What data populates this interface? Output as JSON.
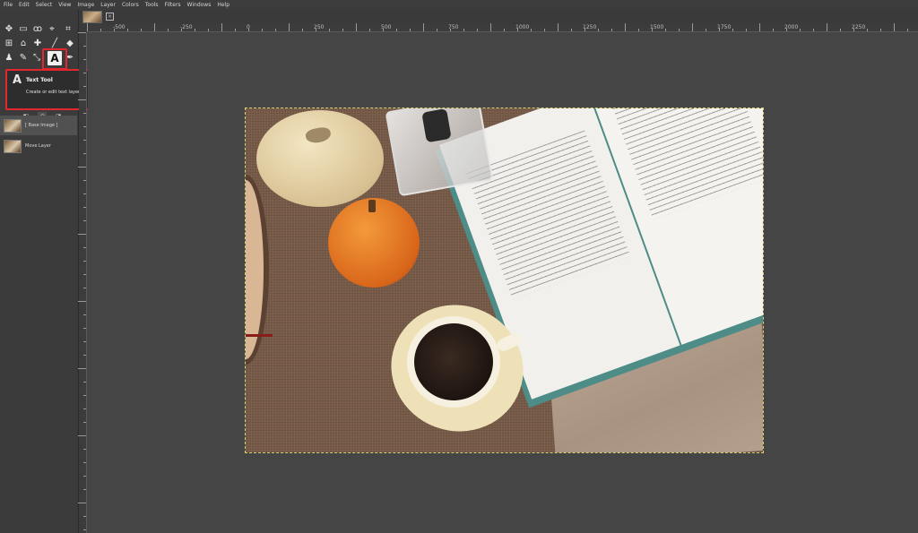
{
  "menubar": {
    "items": [
      "File",
      "Edit",
      "Select",
      "View",
      "Image",
      "Layer",
      "Colors",
      "Tools",
      "Filters",
      "Windows",
      "Help"
    ]
  },
  "toolbox": {
    "tools": [
      {
        "name": "move-tool-icon",
        "glyph": "✥"
      },
      {
        "name": "rect-select-tool-icon",
        "glyph": "▭"
      },
      {
        "name": "lasso-tool-icon",
        "glyph": "ꝏ"
      },
      {
        "name": "foreground-select-tool-icon",
        "glyph": "⌖"
      },
      {
        "name": "crop-tool-icon",
        "glyph": "⌗"
      },
      {
        "name": "unified-transform-tool-icon",
        "glyph": "⊞"
      },
      {
        "name": "warp-tool-icon",
        "glyph": "⌂"
      },
      {
        "name": "cage-tool-icon",
        "glyph": "✚"
      },
      {
        "name": "paintbrush-tool-icon",
        "glyph": "╱"
      },
      {
        "name": "eraser-tool-icon",
        "glyph": "◆"
      },
      {
        "name": "clone-tool-icon",
        "glyph": "♟"
      },
      {
        "name": "smudge-tool-icon",
        "glyph": "✎"
      },
      {
        "name": "measure-tool-icon",
        "glyph": "⤡"
      },
      {
        "name": "text-tool-icon",
        "glyph": "A"
      },
      {
        "name": "color-picker-tool-icon",
        "glyph": "✒"
      }
    ]
  },
  "tooltip": {
    "icon": "A",
    "title": "Text Tool",
    "help": "?",
    "description": "Create or edit text layers"
  },
  "layers": {
    "tabs": [
      "layers-tab-icon",
      "channels-tab-icon",
      "paths-tab-icon",
      "undo-tab-icon"
    ],
    "items": [
      {
        "label": "[ Base Image ]"
      },
      {
        "label": "Move Layer"
      }
    ]
  },
  "ruler": {
    "labels": [
      "-500",
      "-250",
      "0",
      "250",
      "500",
      "750",
      "1000",
      "1250",
      "1500",
      "1750",
      "2000",
      "2250"
    ]
  },
  "colors": {
    "highlight": "#e2282e",
    "panel": "#3b3b3b",
    "canvas_bg": "#454545"
  }
}
